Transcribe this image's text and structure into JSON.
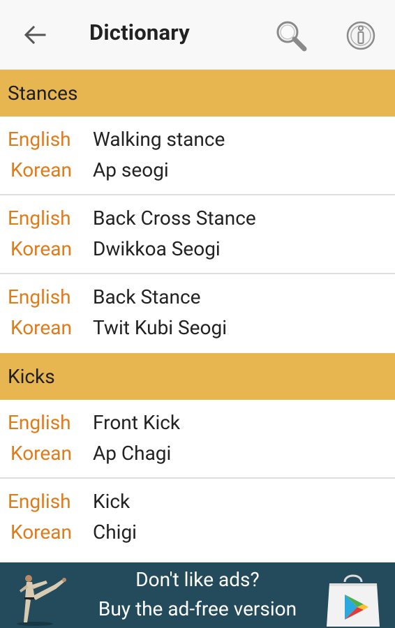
{
  "appbar": {
    "title": "Dictionary",
    "back_icon": "arrow-left-icon",
    "search_icon": "search-icon",
    "info_icon": "info-icon"
  },
  "sections": [
    {
      "header": "Stances",
      "entries": [
        {
          "english_label": "English",
          "english": "Walking stance",
          "korean_label": "Korean",
          "korean": "Ap seogi"
        },
        {
          "english_label": "English",
          "english": "Back Cross Stance",
          "korean_label": "Korean",
          "korean": "Dwikkoa Seogi"
        },
        {
          "english_label": "English",
          "english": "Back Stance",
          "korean_label": "Korean",
          "korean": "Twit Kubi Seogi"
        }
      ]
    },
    {
      "header": "Kicks",
      "entries": [
        {
          "english_label": "English",
          "english": "Front Kick",
          "korean_label": "Korean",
          "korean": "Ap Chagi"
        },
        {
          "english_label": "English",
          "english": "Kick",
          "korean_label": "Korean",
          "korean": "Chigi"
        }
      ]
    }
  ],
  "ad": {
    "line1": "Don't like ads?",
    "line2": "Buy the ad-free version",
    "figure_icon": "martial-artist-icon",
    "store_icon": "play-store-bag-icon"
  },
  "colors": {
    "header_bg": "#e8b650",
    "label": "#e07b1a",
    "ad_bg": "#244b5c"
  }
}
